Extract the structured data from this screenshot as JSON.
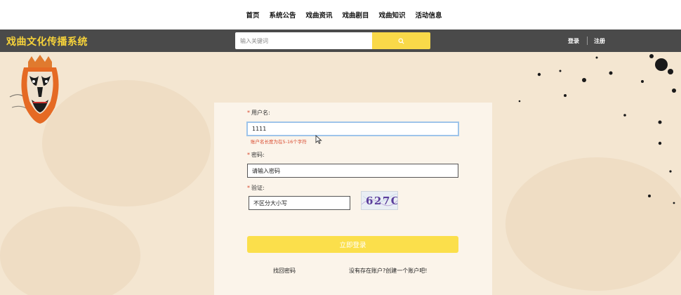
{
  "topnav": {
    "items": [
      "首页",
      "系统公告",
      "戏曲资讯",
      "戏曲剧目",
      "戏曲知识",
      "活动信息"
    ]
  },
  "header": {
    "brand": "戏曲文化传播系统",
    "search_placeholder": "输入关键词",
    "search_icon": "search-icon",
    "login": "登录",
    "register": "注册"
  },
  "form": {
    "username_label": "用户名:",
    "username_value": "1111",
    "username_error": "账户名长度为在5-16个字符",
    "password_label": "密码:",
    "password_placeholder": "请输入密码",
    "captcha_label": "验证:",
    "captcha_placeholder": "不区分大小写",
    "captcha_text": "627C",
    "submit_label": "立即登录",
    "forgot_link": "找回密码",
    "register_link": "没有存在账户?创建一个账户吧!"
  },
  "colors": {
    "brand": "#f7d33a",
    "header_bg": "#4a4a4a",
    "accent_yellow": "#fbdf4b",
    "error": "#d84a2f",
    "page_bg": "#f4e6d1"
  }
}
